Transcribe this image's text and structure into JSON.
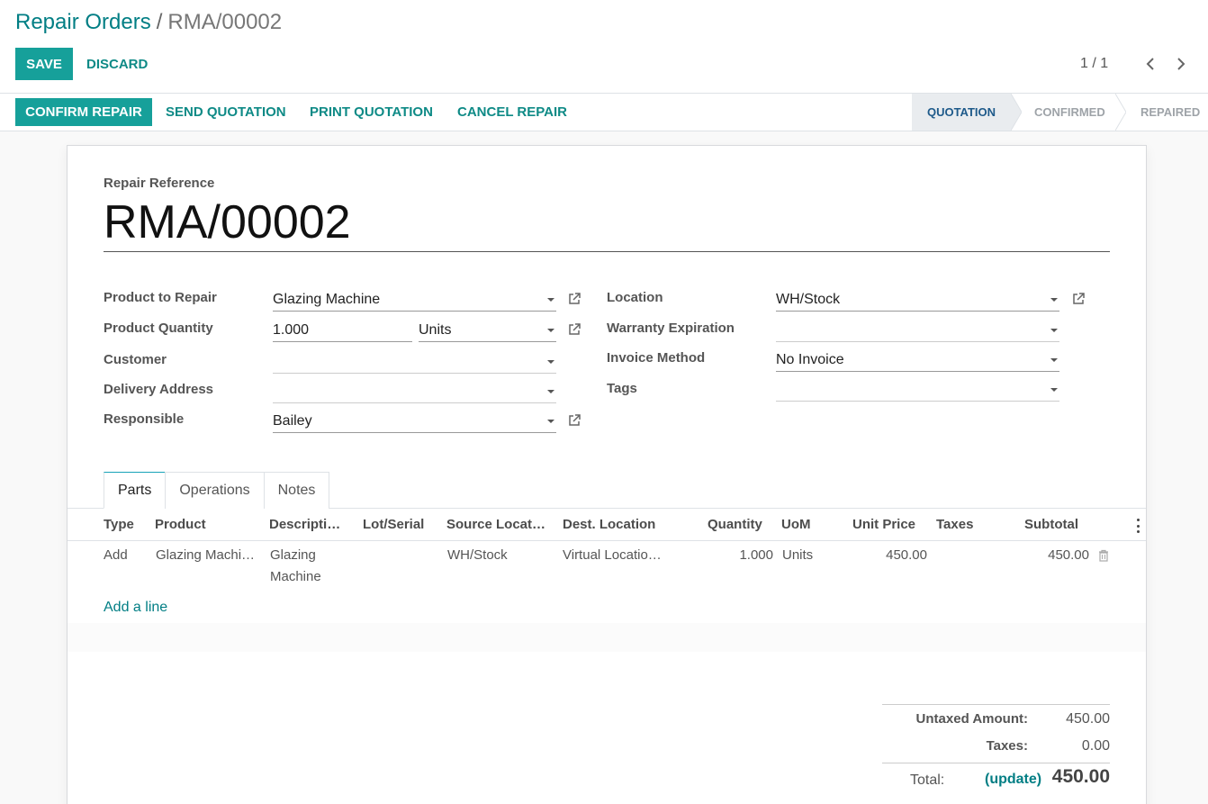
{
  "breadcrumb": {
    "parent": "Repair Orders",
    "separator": "/",
    "current": "RMA/00002"
  },
  "actions": {
    "save": "SAVE",
    "discard": "DISCARD"
  },
  "pager": {
    "value": "1 / 1"
  },
  "header_buttons": {
    "confirm": "CONFIRM REPAIR",
    "send": "SEND QUOTATION",
    "print": "PRINT QUOTATION",
    "cancel": "CANCEL REPAIR"
  },
  "statusbar": {
    "stages": [
      "QUOTATION",
      "CONFIRMED",
      "REPAIRED"
    ],
    "active": "QUOTATION"
  },
  "form": {
    "reference_label": "Repair Reference",
    "reference": "RMA/00002",
    "product_label": "Product to Repair",
    "product": "Glazing Machine",
    "qty_label": "Product Quantity",
    "qty": "1.000",
    "uom": "Units",
    "customer_label": "Customer",
    "customer": "",
    "delivery_label": "Delivery Address",
    "delivery": "",
    "responsible_label": "Responsible",
    "responsible": "Bailey",
    "location_label": "Location",
    "location": "WH/Stock",
    "warranty_label": "Warranty Expiration",
    "warranty": "",
    "invoice_label": "Invoice Method",
    "invoice": "No Invoice",
    "tags_label": "Tags",
    "tags": ""
  },
  "tabs": [
    "Parts",
    "Operations",
    "Notes"
  ],
  "parts_table": {
    "columns": [
      "Type",
      "Product",
      "Descripti…",
      "Lot/Serial",
      "Source Locat…",
      "Dest. Location",
      "Quantity",
      "UoM",
      "Unit Price",
      "Taxes",
      "Subtotal"
    ],
    "rows": [
      {
        "type": "Add",
        "product": "Glazing Machi…",
        "description_1": "Glazing",
        "description_2": "Machine",
        "lot": "",
        "source": "WH/Stock",
        "dest": "Virtual Locatio…",
        "qty": "1.000",
        "uom": "Units",
        "price": "450.00",
        "taxes": "",
        "subtotal": "450.00"
      }
    ],
    "add_line": "Add a line"
  },
  "totals": {
    "untaxed_label": "Untaxed Amount:",
    "untaxed": "450.00",
    "taxes_label": "Taxes:",
    "taxes": "0.00",
    "total_label": "Total:",
    "update": "(update)",
    "total": "450.00"
  },
  "colors": {
    "brand": "#16a09a",
    "link": "#017e84",
    "stage_active": "#1e5a8a"
  }
}
